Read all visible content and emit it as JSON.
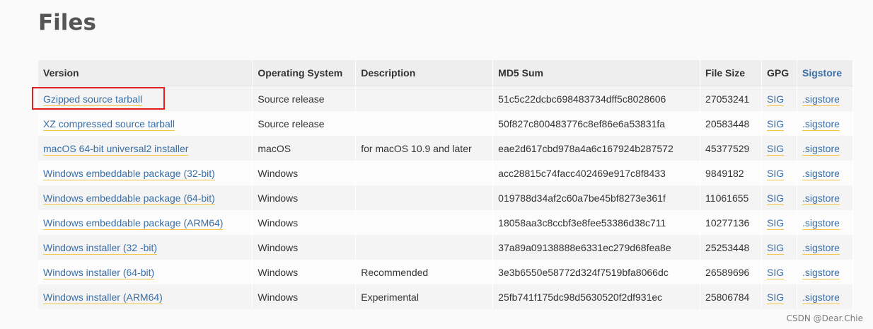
{
  "page": {
    "title": "Files"
  },
  "table": {
    "headers": {
      "version": "Version",
      "os": "Operating System",
      "description": "Description",
      "md5": "MD5 Sum",
      "size": "File Size",
      "gpg": "GPG",
      "sigstore": "Sigstore"
    },
    "rows": [
      {
        "version": "Gzipped source tarball",
        "os": "Source release",
        "description": "",
        "md5": "51c5c22dcbc698483734dff5c8028606",
        "size": "27053241",
        "gpg": "SIG",
        "sigstore": ".sigstore"
      },
      {
        "version": "XZ compressed source tarball",
        "os": "Source release",
        "description": "",
        "md5": "50f827c800483776c8ef86e6a53831fa",
        "size": "20583448",
        "gpg": "SIG",
        "sigstore": ".sigstore"
      },
      {
        "version": "macOS 64-bit universal2 installer",
        "os": "macOS",
        "description": "for macOS 10.9 and later",
        "md5": "eae2d617cbd978a4a6c167924b287572",
        "size": "45377529",
        "gpg": "SIG",
        "sigstore": ".sigstore"
      },
      {
        "version": "Windows embeddable package (32-bit)",
        "os": "Windows",
        "description": "",
        "md5": "acc28815c74facc402469e917c8f8433",
        "size": "9849182",
        "gpg": "SIG",
        "sigstore": ".sigstore"
      },
      {
        "version": "Windows embeddable package (64-bit)",
        "os": "Windows",
        "description": "",
        "md5": "019788d34af2c60a7be45bf8273e361f",
        "size": "11061655",
        "gpg": "SIG",
        "sigstore": ".sigstore"
      },
      {
        "version": "Windows embeddable package (ARM64)",
        "os": "Windows",
        "description": "",
        "md5": "18058aa3c8ccbf3e8fee53386d38c711",
        "size": "10277136",
        "gpg": "SIG",
        "sigstore": ".sigstore"
      },
      {
        "version": "Windows installer (32 -bit)",
        "os": "Windows",
        "description": "",
        "md5": "37a89a09138888e6331ec279d68fea8e",
        "size": "25253448",
        "gpg": "SIG",
        "sigstore": ".sigstore"
      },
      {
        "version": "Windows installer (64-bit)",
        "os": "Windows",
        "description": "Recommended",
        "md5": "3e3b6550e58772d324f7519bfa8066dc",
        "size": "26589696",
        "gpg": "SIG",
        "sigstore": ".sigstore"
      },
      {
        "version": "Windows installer (ARM64)",
        "os": "Windows",
        "description": "Experimental",
        "md5": "25fb741f175dc98d5630520f2df931ec",
        "size": "25806784",
        "gpg": "SIG",
        "sigstore": ".sigstore"
      }
    ]
  },
  "watermark": "CSDN @Dear.Chie",
  "colors": {
    "link": "#3a6fa7",
    "link_underline": "#f5c542",
    "highlight": "#e02020"
  }
}
